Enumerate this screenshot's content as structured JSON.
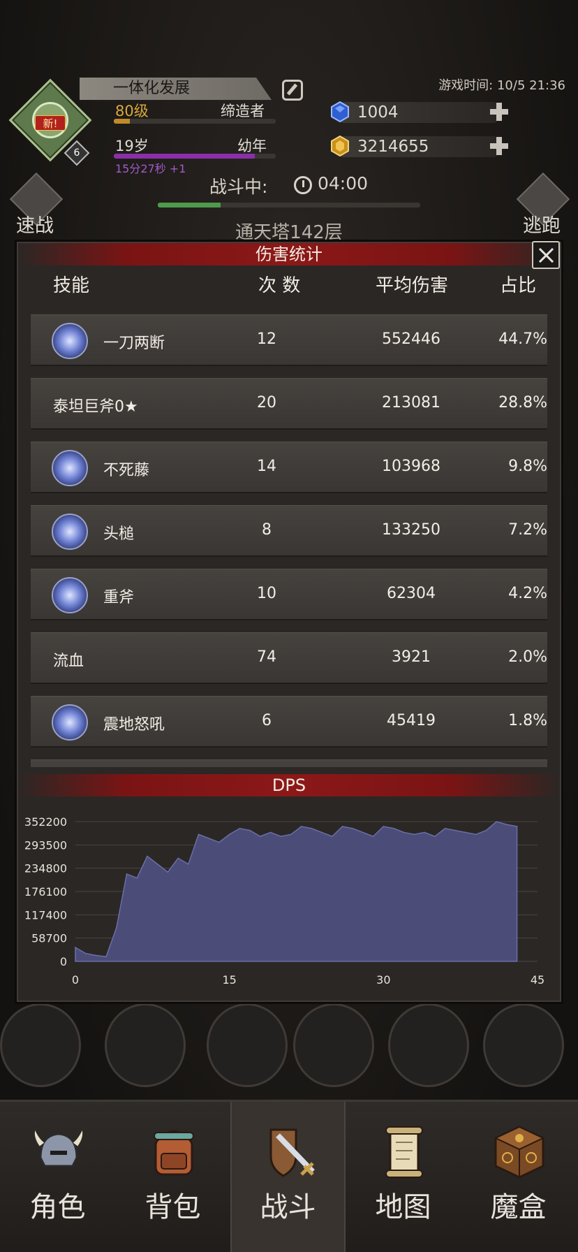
{
  "header": {
    "avatar_new": "新!",
    "avatar_level": "6",
    "title": "一体化发展",
    "level": "80级",
    "class": "缔造者",
    "age": "19岁",
    "stage": "幼年",
    "timer": "15分27秒 +1",
    "game_time": "游戏时间: 10/5 21:36",
    "gems": "1004",
    "gold": "3214655",
    "level_progress": 0.1,
    "age_progress": 0.87
  },
  "battle": {
    "status": "战斗中:",
    "time": "04:00",
    "progress": 0.24,
    "quick_battle": "速战",
    "escape": "逃跑",
    "tower": "通天塔142层"
  },
  "damage_panel": {
    "title": "伤害统计",
    "columns": [
      "技能",
      "次 数",
      "平均伤害",
      "占比"
    ],
    "rows": [
      {
        "name": "一刀两断",
        "count": "12",
        "avg": "552446",
        "pct": "44.7%",
        "icon": "blade-slash-icon"
      },
      {
        "name": "泰坦巨斧0★",
        "count": "20",
        "avg": "213081",
        "pct": "28.8%",
        "icon": ""
      },
      {
        "name": "不死藤",
        "count": "14",
        "avg": "103968",
        "pct": "9.8%",
        "icon": "lightning-vine-icon"
      },
      {
        "name": "头槌",
        "count": "8",
        "avg": "133250",
        "pct": "7.2%",
        "icon": "headbutt-icon"
      },
      {
        "name": "重斧",
        "count": "10",
        "avg": "62304",
        "pct": "4.2%",
        "icon": "sword-icon"
      },
      {
        "name": "流血",
        "count": "74",
        "avg": "3921",
        "pct": "2.0%",
        "icon": ""
      },
      {
        "name": "震地怒吼",
        "count": "6",
        "avg": "45419",
        "pct": "1.8%",
        "icon": "roar-icon"
      }
    ]
  },
  "chart_data": {
    "type": "area",
    "title": "DPS",
    "xlabel": "",
    "ylabel": "",
    "x_ticks": [
      "0",
      "15",
      "30",
      "45"
    ],
    "y_ticks": [
      "352200",
      "293500",
      "234800",
      "176100",
      "117400",
      "58700",
      "0"
    ],
    "xlim": [
      0,
      45
    ],
    "ylim": [
      0,
      352200
    ],
    "color": "#4b4d78",
    "x": [
      0,
      1,
      2,
      3,
      4,
      5,
      6,
      7,
      8,
      9,
      10,
      11,
      12,
      13,
      14,
      15,
      16,
      17,
      18,
      19,
      20,
      21,
      22,
      23,
      24,
      25,
      26,
      27,
      28,
      29,
      30,
      31,
      32,
      33,
      34,
      35,
      36,
      37,
      38,
      39,
      40,
      41,
      42,
      43
    ],
    "y": [
      35000,
      20000,
      15000,
      12000,
      85000,
      220000,
      210000,
      265000,
      245000,
      225000,
      260000,
      245000,
      320000,
      310000,
      300000,
      320000,
      335000,
      330000,
      315000,
      325000,
      315000,
      320000,
      340000,
      335000,
      325000,
      315000,
      340000,
      335000,
      325000,
      315000,
      340000,
      335000,
      325000,
      320000,
      325000,
      315000,
      335000,
      330000,
      325000,
      320000,
      330000,
      352000,
      345000,
      340000
    ]
  },
  "bottom_nav": [
    {
      "label": "角色",
      "icon": "helmet-icon"
    },
    {
      "label": "背包",
      "icon": "backpack-icon"
    },
    {
      "label": "战斗",
      "icon": "shield-sword-icon"
    },
    {
      "label": "地图",
      "icon": "scroll-map-icon"
    },
    {
      "label": "魔盒",
      "icon": "magic-box-icon"
    }
  ]
}
